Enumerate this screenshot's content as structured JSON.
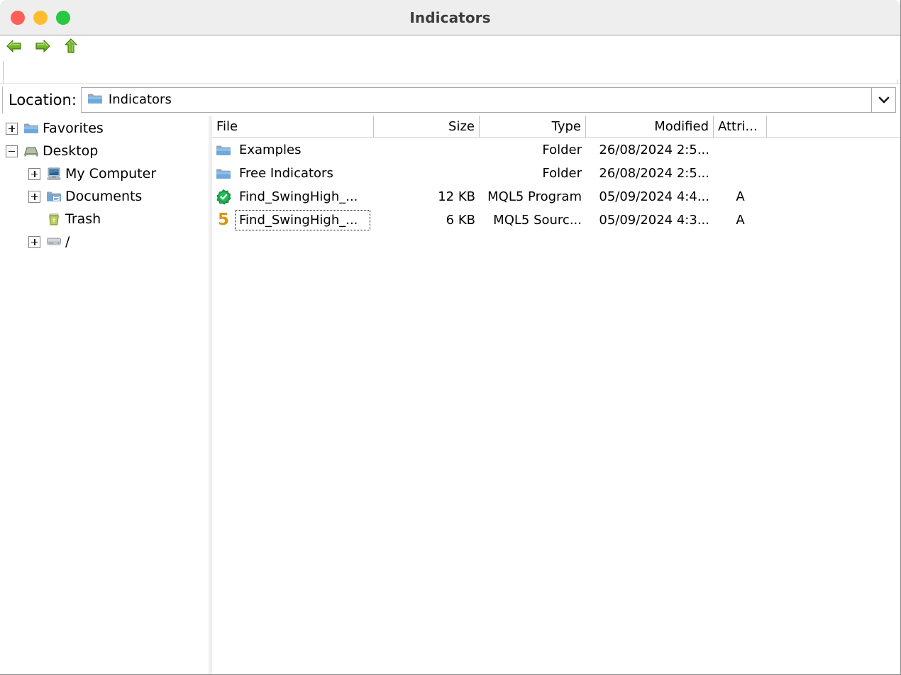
{
  "window": {
    "title": "Indicators",
    "controls": [
      {
        "name": "close",
        "color": "#ff5f57"
      },
      {
        "name": "minimize",
        "color": "#ffbd2e"
      },
      {
        "name": "maximize",
        "color": "#26c940"
      }
    ]
  },
  "toolbar": {
    "buttons": [
      {
        "icon": "back-arrow-icon",
        "label": "Back"
      },
      {
        "icon": "forward-arrow-icon",
        "label": "Forward"
      },
      {
        "icon": "up-arrow-icon",
        "label": "Parent folder"
      }
    ]
  },
  "location": {
    "label": "Location:",
    "value": "Indicators",
    "icon": "folder-icon",
    "dropdown_icon": "chevron-down-icon"
  },
  "sidebar": {
    "items": [
      {
        "label": "Favorites",
        "icon": "folder-icon",
        "expander": "plus",
        "indent": 0
      },
      {
        "label": "Desktop",
        "icon": "desktop-icon",
        "expander": "minus",
        "indent": 0
      },
      {
        "label": "My Computer",
        "icon": "computer-icon",
        "expander": "plus",
        "indent": 1
      },
      {
        "label": "Documents",
        "icon": "documents-icon",
        "expander": "plus",
        "indent": 1
      },
      {
        "label": "Trash",
        "icon": "trash-icon",
        "expander": "none",
        "indent": 1
      },
      {
        "label": "/",
        "icon": "harddrive-icon",
        "expander": "plus",
        "indent": 0
      }
    ]
  },
  "filelist": {
    "columns": [
      {
        "key": "file",
        "label": "File",
        "align": "left"
      },
      {
        "key": "size",
        "label": "Size",
        "align": "right"
      },
      {
        "key": "type",
        "label": "Type",
        "align": "right"
      },
      {
        "key": "modified",
        "label": "Modified",
        "align": "right"
      },
      {
        "key": "attr",
        "label": "Attri...",
        "align": "left"
      }
    ],
    "rows": [
      {
        "name": "Examples",
        "icon": "folder-icon",
        "size": "",
        "type": "Folder",
        "modified": "26/08/2024 2:5...",
        "attr": "",
        "focused": false
      },
      {
        "name": "Free Indicators",
        "icon": "folder-icon",
        "size": "",
        "type": "Folder",
        "modified": "26/08/2024 2:5...",
        "attr": "",
        "focused": false
      },
      {
        "name": "Find_SwingHigh_...",
        "icon": "mql5-program-icon",
        "size": "12 KB",
        "type": "MQL5 Program",
        "modified": "05/09/2024 4:4...",
        "attr": "A",
        "focused": false
      },
      {
        "name": "Find_SwingHigh_...",
        "icon": "mql5-source-icon",
        "size": "6 KB",
        "type": "MQL5 Sourc...",
        "modified": "05/09/2024 4:3...",
        "attr": "A",
        "focused": true
      }
    ]
  }
}
